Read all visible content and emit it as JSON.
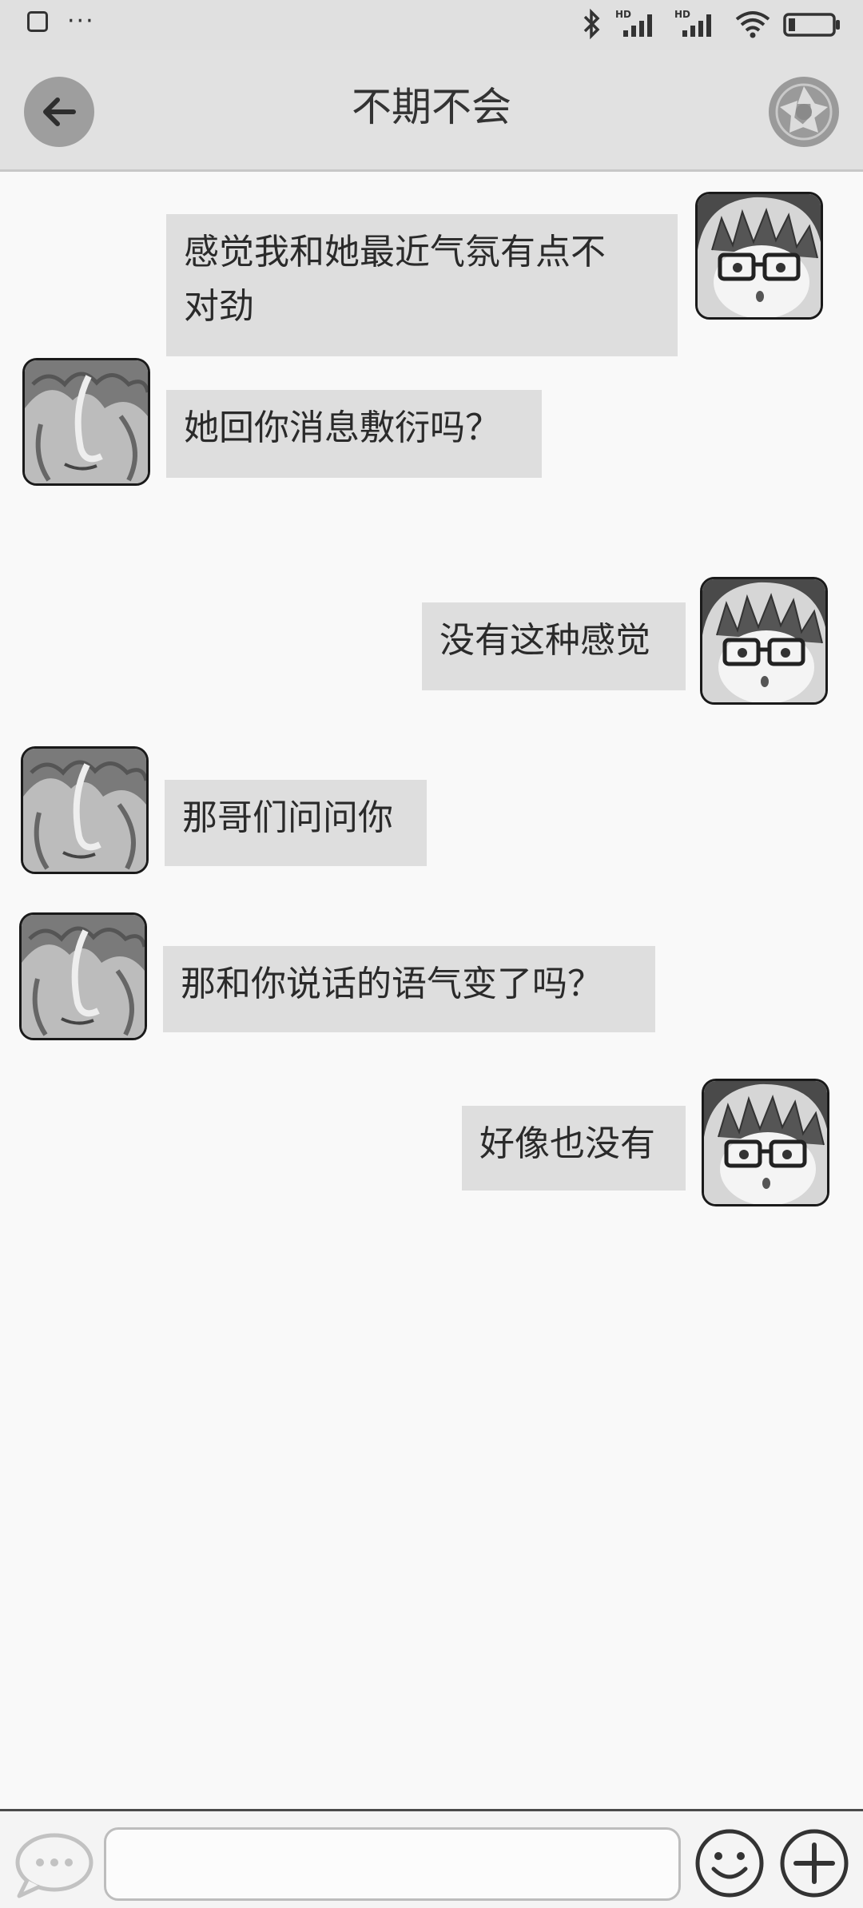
{
  "header": {
    "title": "不期不会"
  },
  "messages": [
    {
      "side": "right",
      "text_lines": [
        "感觉我和她最近气氛有点不",
        "对劲"
      ]
    },
    {
      "side": "left",
      "text": "她回你消息敷衍吗？"
    },
    {
      "side": "right",
      "text": "没有这种感觉"
    },
    {
      "side": "left",
      "text": "那哥们问问你"
    },
    {
      "side": "left",
      "text": "那和你说话的语气变了吗？"
    },
    {
      "side": "right",
      "text": "好像也没有"
    }
  ],
  "input": {
    "value": "",
    "placeholder": ""
  },
  "icons": {
    "back": "arrow-left-icon",
    "camera": "aperture-icon",
    "voice": "chat-bubble-icon",
    "emoji": "smiley-icon",
    "plus": "plus-circle-icon"
  },
  "colors": {
    "bubble": "#dedede",
    "header": "#e1e1e1",
    "background": "#f9f9f9"
  }
}
